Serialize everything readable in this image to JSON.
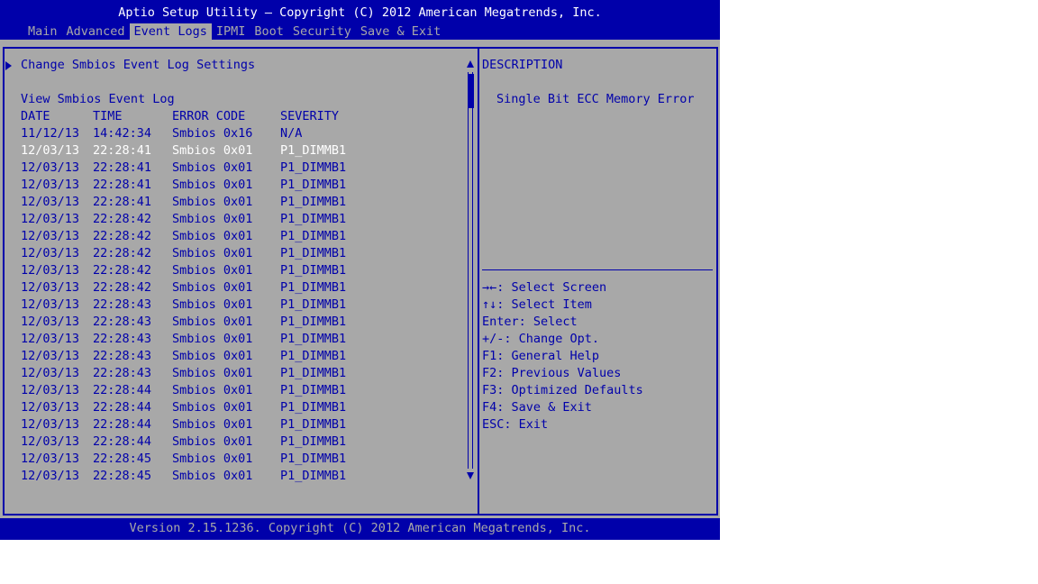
{
  "header": {
    "title": "Aptio Setup Utility – Copyright (C) 2012 American Megatrends, Inc.",
    "tabs": [
      "Main",
      "Advanced",
      "Event Logs",
      "IPMI",
      "Boot",
      "Security",
      "Save & Exit"
    ],
    "active_tab": "Event Logs"
  },
  "left": {
    "menu_item": "Change Smbios Event Log Settings",
    "section_label": "View Smbios Event Log",
    "columns": [
      "DATE",
      "TIME",
      "ERROR CODE",
      "SEVERITY"
    ],
    "rows": [
      [
        "11/12/13",
        "14:42:34",
        "Smbios 0x16",
        "N/A"
      ],
      [
        "12/03/13",
        "22:28:41",
        "Smbios 0x01",
        "P1_DIMMB1"
      ],
      [
        "12/03/13",
        "22:28:41",
        "Smbios 0x01",
        "P1_DIMMB1"
      ],
      [
        "12/03/13",
        "22:28:41",
        "Smbios 0x01",
        "P1_DIMMB1"
      ],
      [
        "12/03/13",
        "22:28:41",
        "Smbios 0x01",
        "P1_DIMMB1"
      ],
      [
        "12/03/13",
        "22:28:42",
        "Smbios 0x01",
        "P1_DIMMB1"
      ],
      [
        "12/03/13",
        "22:28:42",
        "Smbios 0x01",
        "P1_DIMMB1"
      ],
      [
        "12/03/13",
        "22:28:42",
        "Smbios 0x01",
        "P1_DIMMB1"
      ],
      [
        "12/03/13",
        "22:28:42",
        "Smbios 0x01",
        "P1_DIMMB1"
      ],
      [
        "12/03/13",
        "22:28:42",
        "Smbios 0x01",
        "P1_DIMMB1"
      ],
      [
        "12/03/13",
        "22:28:43",
        "Smbios 0x01",
        "P1_DIMMB1"
      ],
      [
        "12/03/13",
        "22:28:43",
        "Smbios 0x01",
        "P1_DIMMB1"
      ],
      [
        "12/03/13",
        "22:28:43",
        "Smbios 0x01",
        "P1_DIMMB1"
      ],
      [
        "12/03/13",
        "22:28:43",
        "Smbios 0x01",
        "P1_DIMMB1"
      ],
      [
        "12/03/13",
        "22:28:43",
        "Smbios 0x01",
        "P1_DIMMB1"
      ],
      [
        "12/03/13",
        "22:28:44",
        "Smbios 0x01",
        "P1_DIMMB1"
      ],
      [
        "12/03/13",
        "22:28:44",
        "Smbios 0x01",
        "P1_DIMMB1"
      ],
      [
        "12/03/13",
        "22:28:44",
        "Smbios 0x01",
        "P1_DIMMB1"
      ],
      [
        "12/03/13",
        "22:28:44",
        "Smbios 0x01",
        "P1_DIMMB1"
      ],
      [
        "12/03/13",
        "22:28:45",
        "Smbios 0x01",
        "P1_DIMMB1"
      ],
      [
        "12/03/13",
        "22:28:45",
        "Smbios 0x01",
        "P1_DIMMB1"
      ]
    ],
    "highlighted_row_index": 1
  },
  "right": {
    "description_label": "DESCRIPTION",
    "description_text": "Single Bit ECC Memory Error",
    "help": [
      "→←: Select Screen",
      "↑↓: Select Item",
      "Enter: Select",
      "+/-: Change Opt.",
      "F1: General Help",
      "F2: Previous Values",
      "F3: Optimized Defaults",
      "F4: Save & Exit",
      "ESC: Exit"
    ]
  },
  "footer": {
    "text": "Version 2.15.1236. Copyright (C) 2012 American Megatrends, Inc."
  },
  "colors": {
    "blue": "#0000aa",
    "gray": "#a8a8a8",
    "white": "#ffffff"
  }
}
